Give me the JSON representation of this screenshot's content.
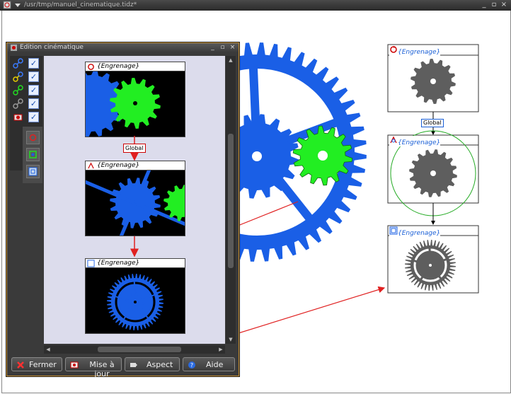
{
  "window": {
    "title": "/usr/tmp/manuel_cinematique.tidz*"
  },
  "canvas": {
    "nodes": [
      {
        "label": "{Engrenage}"
      },
      {
        "label": "{Engrenage}"
      },
      {
        "label": "{Engrenage}"
      }
    ],
    "global_tag": "Global"
  },
  "panel": {
    "title": "Edition cinématique",
    "viewport_nodes": [
      {
        "label": "{Engrenage}"
      },
      {
        "label": "{Engrenage}"
      },
      {
        "label": "{Engrenage}"
      }
    ],
    "global_tag": "Global",
    "buttons": {
      "close": "Fermer",
      "update": "Mise à jour",
      "aspect": "Aspect",
      "help": "Aide"
    }
  },
  "colors": {
    "gear_blue": "#1a5fe6",
    "gear_green": "#22ee22",
    "gear_gray": "#5e5e5e",
    "arrow_red": "#e02020",
    "panel_border": "#c89030"
  }
}
